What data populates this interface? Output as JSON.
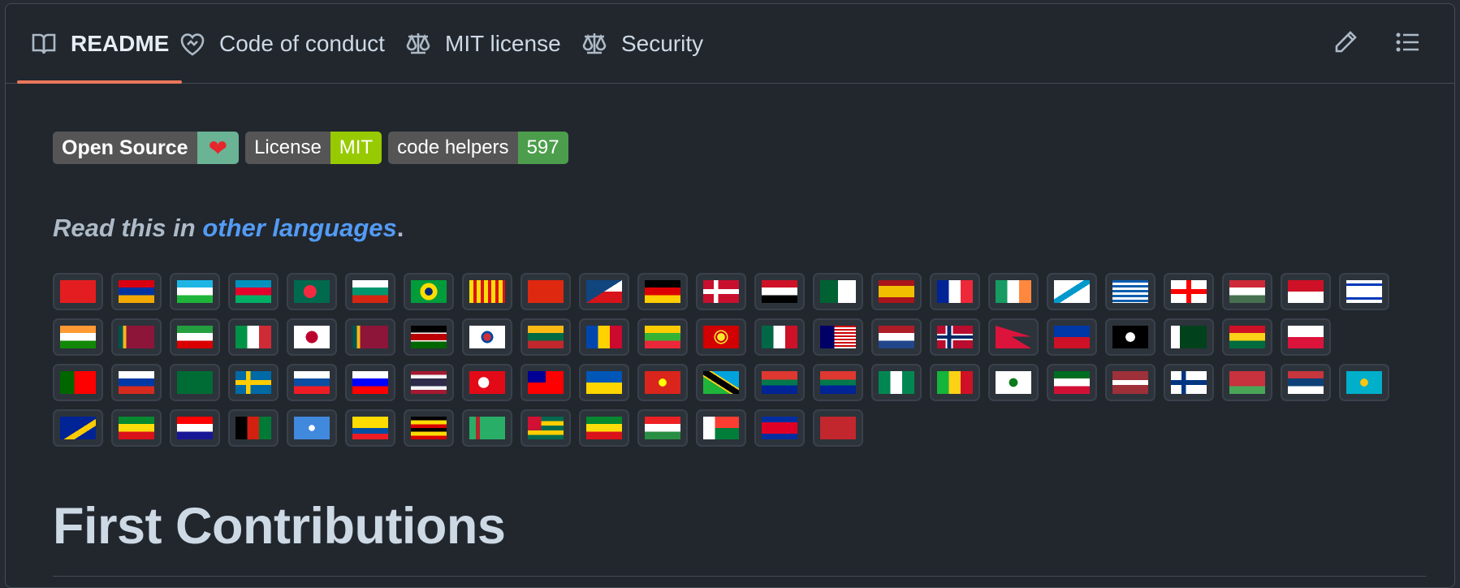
{
  "tabs": [
    {
      "label": "README",
      "icon": "book-icon",
      "active": true
    },
    {
      "label": "Code of conduct",
      "icon": "code-of-conduct-icon",
      "active": false
    },
    {
      "label": "MIT license",
      "icon": "law-icon",
      "active": false
    },
    {
      "label": "Security",
      "icon": "law-icon",
      "active": false
    }
  ],
  "toolbar": {
    "edit_icon": "pencil-icon",
    "outline_icon": "list-icon"
  },
  "badges": [
    {
      "left": "Open Source",
      "right": "❤",
      "right_color": "#6ab395"
    },
    {
      "left": "License",
      "right": "MIT",
      "right_color": "#97ca00"
    },
    {
      "left": "code helpers",
      "right": "597",
      "right_color": "#4c9e4c"
    }
  ],
  "read_in": {
    "prefix": "Read this in ",
    "link": "other languages",
    "suffix": "."
  },
  "flags": [
    [
      "Albania",
      "Armenia",
      "Uzbekistan",
      "Azerbaijan",
      "Bangladesh",
      "Bulgaria",
      "Brazil",
      "Catalonia",
      "China",
      "Czech Republic",
      "Germany",
      "Denmark",
      "Egypt",
      "Algeria",
      "Spain",
      "France",
      "Ireland",
      "Galicia",
      "Greece",
      "Georgia",
      "Hungary",
      "Indonesia",
      "Israel"
    ],
    [
      "India",
      "Sri Lanka",
      "Iran",
      "Italy",
      "Japan",
      "Sri Lanka",
      "Kenya",
      "South Korea",
      "Lithuania",
      "Moldova",
      "Myanmar",
      "North Macedonia",
      "Mexico",
      "Malaysia",
      "Netherlands",
      "Norway",
      "Nepal",
      "Philippines",
      "Pirate",
      "Pakistan",
      "Ghana",
      "Poland"
    ],
    [
      "Portugal",
      "Russia",
      "Saudi Arabia",
      "Sweden",
      "Slovakia",
      "Slovenia",
      "Thailand",
      "Turkey",
      "Taiwan",
      "Ukraine",
      "Vietnam",
      "Tanzania",
      "South Africa",
      "South Africa",
      "Nigeria",
      "Mali",
      "Esperanto",
      "Somaliland",
      "Latvia",
      "Finland",
      "Belarus",
      "Serbia",
      "Kazakhstan"
    ],
    [
      "Bosnia",
      "Ethiopia",
      "Croatia",
      "Afghanistan",
      "Somalia",
      "Ecuador",
      "Uganda",
      "Turkmenistan",
      "Togo",
      "Ethiopia",
      "Kurdistan",
      "Madagascar",
      "Cambodia",
      "Morocco"
    ]
  ],
  "heading": "First Contributions"
}
